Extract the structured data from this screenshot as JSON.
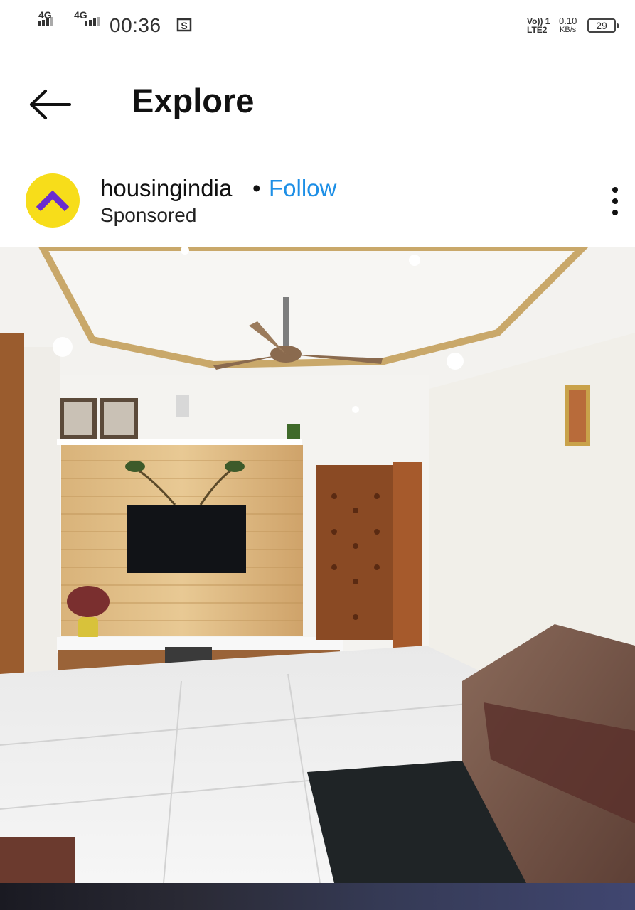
{
  "status_bar": {
    "sim1": "4G",
    "sim2": "4G",
    "time": "00:36",
    "volte_top": "Vo)) 1",
    "volte_bottom": "LTE2",
    "speed_value": "0.10",
    "speed_unit": "KB/s",
    "battery": "29"
  },
  "header": {
    "title": "Explore"
  },
  "post": {
    "username": "housingindia",
    "separator": "•",
    "follow": "Follow",
    "subtitle": "Sponsored",
    "brand_color": "#f7dd1a",
    "accent_color": "#1d8fe6"
  },
  "icons": {
    "back": "arrow-left-icon",
    "more": "more-vertical-icon",
    "screenshot": "screenshot-icon"
  }
}
